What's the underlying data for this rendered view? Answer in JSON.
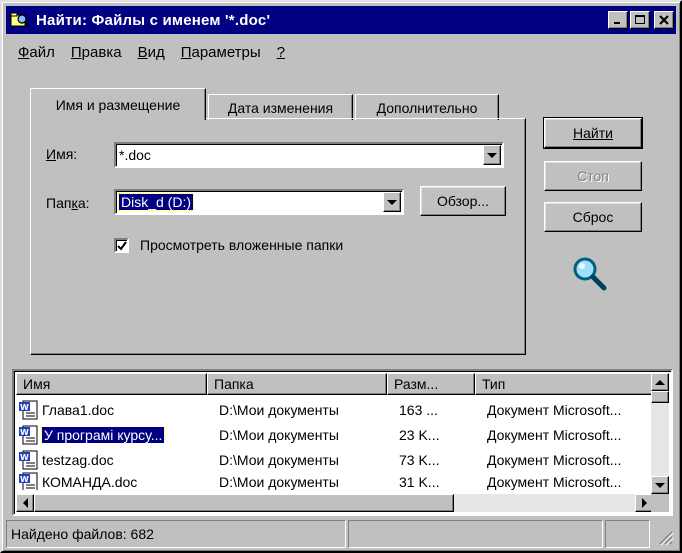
{
  "window": {
    "title": "Найти: Файлы с именем '*.doc'"
  },
  "menu": [
    {
      "label": "Файл",
      "ul": "Ф",
      "rest": "айл"
    },
    {
      "label": "Правка",
      "ul": "П",
      "rest": "равка"
    },
    {
      "label": "Вид",
      "ul": "В",
      "rest": "ид"
    },
    {
      "label": "Параметры",
      "ul": "П",
      "rest": "араметры"
    },
    {
      "label": "?",
      "ul": "?",
      "rest": ""
    }
  ],
  "tabs": [
    {
      "label": "Имя и размещение"
    },
    {
      "label": "Дата изменения"
    },
    {
      "label": "Дополнительно"
    }
  ],
  "form": {
    "name_label": "Имя:",
    "name_value": "*.doc",
    "folder_label": "Папка:",
    "folder_value": "Disk_d (D:)",
    "browse_label": "Обзор...",
    "subfolders_label": "Просмотреть вложенные папки",
    "subfolders_checked": true
  },
  "buttons": {
    "find": "Найти",
    "stop": "Стоп",
    "reset": "Сброс"
  },
  "results": {
    "columns": [
      "Имя",
      "Папка",
      "Разм...",
      "Тип"
    ],
    "rows": [
      {
        "name": "Глава1.doc",
        "folder": "D:\\Мои документы",
        "size": "163 ...",
        "type": "Документ Microsoft..."
      },
      {
        "name": "У програмі курсу...",
        "folder": "D:\\Мои документы",
        "size": "23 K...",
        "type": "Документ Microsoft..."
      },
      {
        "name": "testzag.doc",
        "folder": "D:\\Мои документы",
        "size": "73 K...",
        "type": "Документ Microsoft..."
      },
      {
        "name": "КОМАНДА.doc",
        "folder": "D:\\Мои документы",
        "size": "31 K...",
        "type": "Документ Microsoft..."
      }
    ]
  },
  "status": {
    "found": "Найдено файлов: 682"
  },
  "colors": {
    "title_bg": "#000080",
    "face": "#c0c0c0",
    "selection": "#000080"
  }
}
